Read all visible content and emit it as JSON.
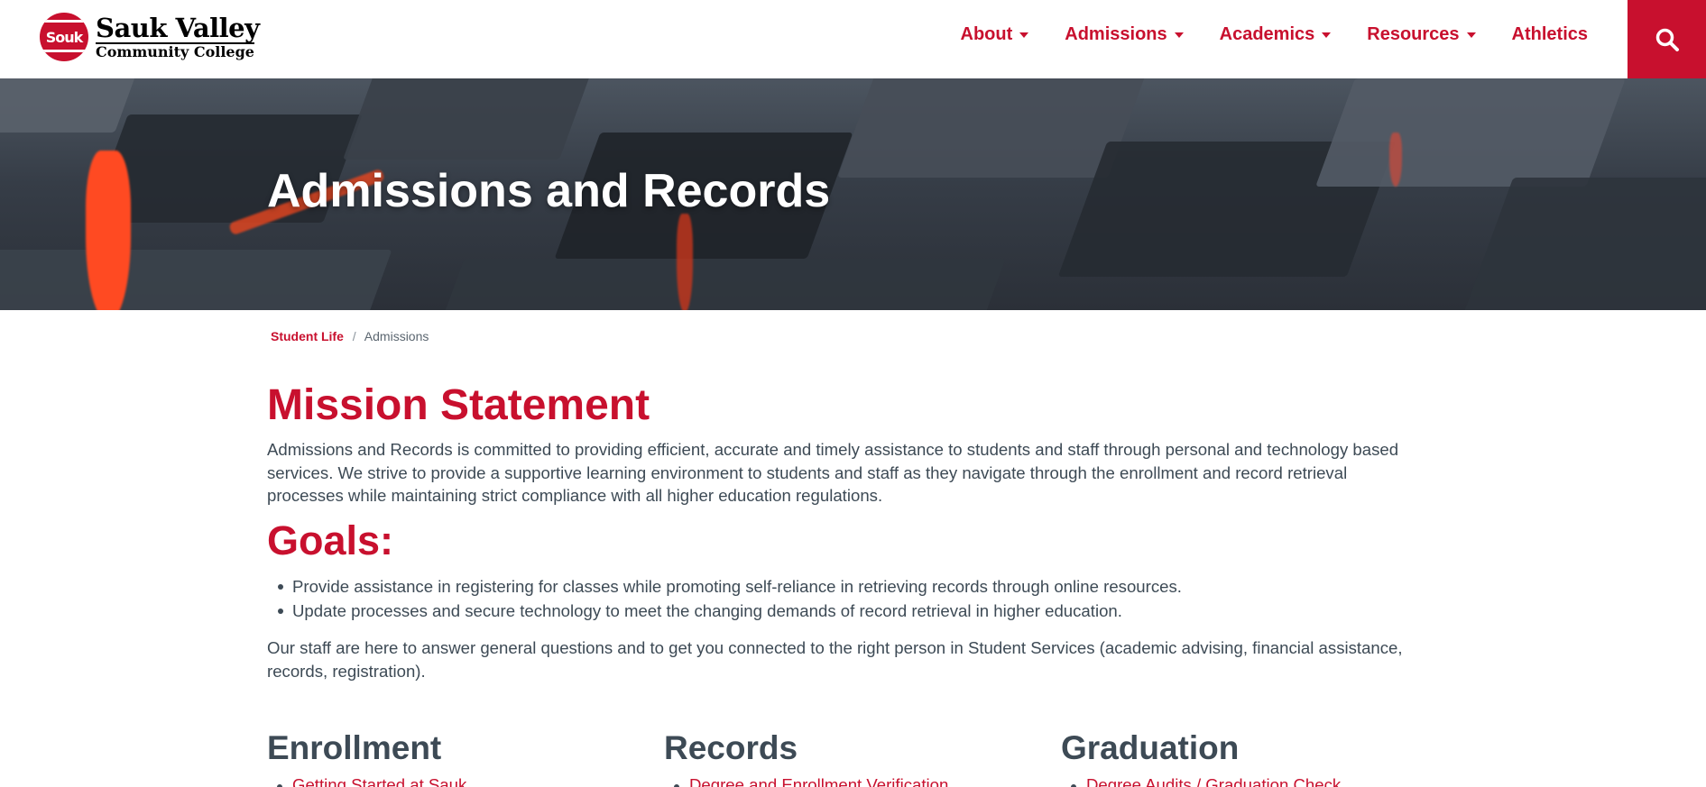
{
  "header": {
    "logo_badge": "Souk",
    "logo_line1": "Sauk Valley",
    "logo_line2": "Community College",
    "nav": [
      {
        "label": "About",
        "has_dropdown": true
      },
      {
        "label": "Admissions",
        "has_dropdown": true
      },
      {
        "label": "Academics",
        "has_dropdown": true
      },
      {
        "label": "Resources",
        "has_dropdown": true
      },
      {
        "label": "Athletics",
        "has_dropdown": false
      }
    ],
    "search_icon": "search-icon"
  },
  "hero": {
    "title": "Admissions and Records"
  },
  "breadcrumb": {
    "link": "Student Life",
    "separator": "/",
    "current": "Admissions"
  },
  "mission": {
    "title": "Mission Statement",
    "text": "Admissions and Records is committed to providing efficient, accurate and timely assistance to students and staff through personal and technology based services. We strive to provide a supportive learning environment to students and staff as they navigate through the enrollment and record retrieval processes while maintaining strict compliance with all higher education regulations."
  },
  "goals": {
    "title": "Goals:",
    "items": [
      "Provide assistance in registering for classes while promoting self-reliance in retrieving records through online resources.",
      "Update processes and secure technology to meet the changing demands of record retrieval in higher education."
    ]
  },
  "staff_text": "Our staff are here to answer general questions and to get you connected to the right person in Student Services (academic advising, financial assistance, records, registration).",
  "columns": [
    {
      "title": "Enrollment",
      "first_link": "Getting Started at Sauk"
    },
    {
      "title": "Records",
      "first_link": "Degree and Enrollment Verification"
    },
    {
      "title": "Graduation",
      "first_link": "Degree Audits / Graduation Check"
    }
  ],
  "colors": {
    "brand_red": "#c8102e",
    "body_text": "#3d4a55"
  }
}
